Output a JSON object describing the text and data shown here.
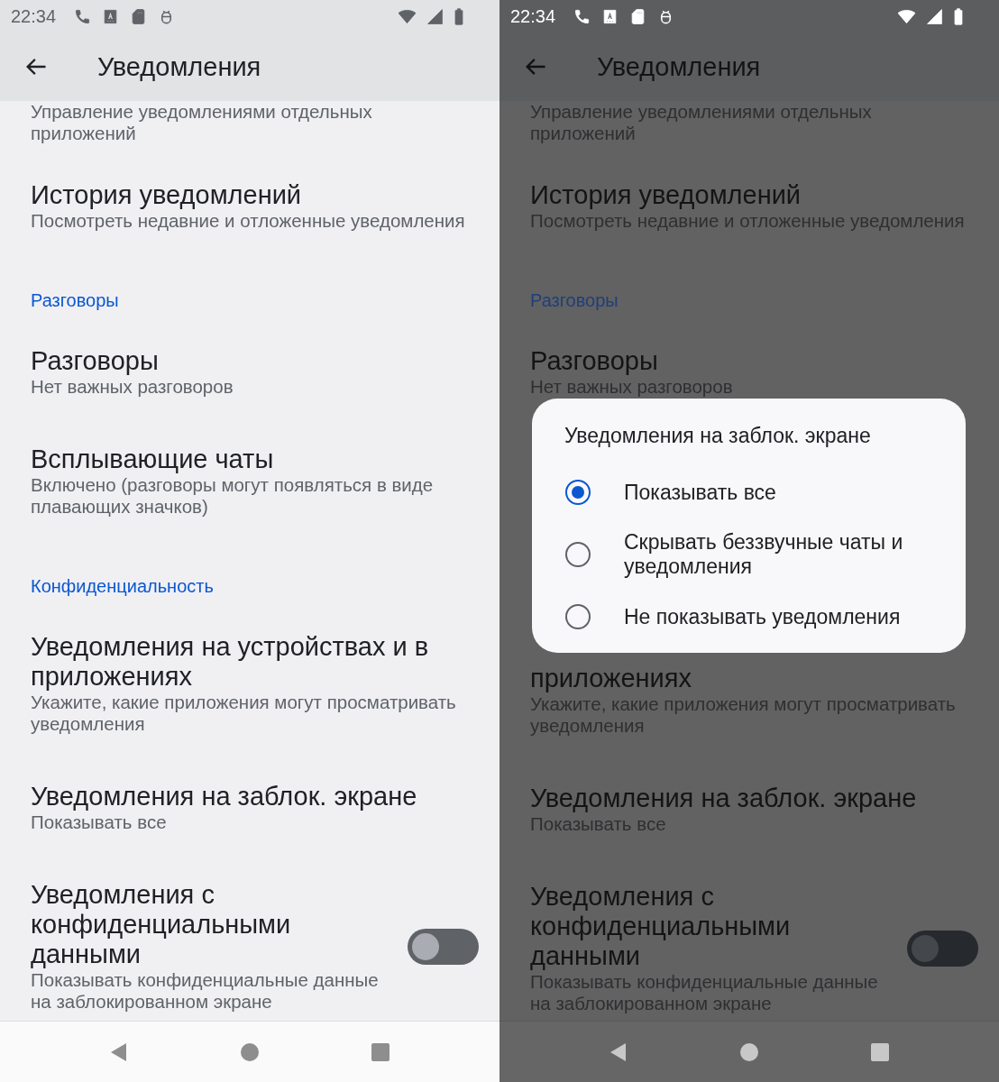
{
  "screens": [
    {
      "dimmed": false,
      "status_bar": {
        "time": "22:34"
      },
      "app_bar": {
        "title": "Уведомления"
      },
      "list": [
        {
          "kind": "item",
          "subtitle": "Управление уведомлениями отдельных приложений"
        },
        {
          "kind": "item",
          "title": "История уведомлений",
          "subtitle": "Посмотреть недавние и отложенные уведомления"
        },
        {
          "kind": "header",
          "title": "Разговоры"
        },
        {
          "kind": "item",
          "title": "Разговоры",
          "subtitle": "Нет важных разговоров"
        },
        {
          "kind": "item",
          "title": "Всплывающие чаты",
          "subtitle": "Включено (разговоры могут появляться в виде плавающих значков)"
        },
        {
          "kind": "header",
          "title": "Конфиденциальность"
        },
        {
          "kind": "item",
          "title": "Уведомления на устройствах и в приложениях",
          "subtitle": "Укажите, какие приложения могут просматривать уведомления"
        },
        {
          "kind": "item",
          "title": "Уведомления на заблок. экране",
          "subtitle": "Показывать все"
        },
        {
          "kind": "toggle",
          "title": "Уведомления с конфиденциальными данными",
          "subtitle": "Показывать конфиденциальные данные на заблокированном экране",
          "on": false
        }
      ]
    },
    {
      "dimmed": true,
      "status_bar": {
        "time": "22:34"
      },
      "app_bar": {
        "title": "Уведомления"
      },
      "list": [
        {
          "kind": "item",
          "subtitle": "Управление уведомлениями отдельных приложений"
        },
        {
          "kind": "item",
          "title": "История уведомлений",
          "subtitle": "Посмотреть недавние и отложенные уведомления"
        },
        {
          "kind": "header",
          "title": "Разговоры"
        },
        {
          "kind": "item",
          "title": "Разговоры",
          "subtitle": "Нет важных разговоров"
        },
        {
          "kind": "dialog",
          "title": "Уведомления на заблок. экране",
          "options": [
            {
              "label": "Показывать все",
              "selected": true
            },
            {
              "label": "Скрывать беззвучные чаты и уведомления",
              "selected": false
            },
            {
              "label": "Не показывать уведомления",
              "selected": false
            }
          ]
        },
        {
          "kind": "item",
          "title": "приложениях",
          "subtitle": "Укажите, какие приложения могут просматривать уведомления"
        },
        {
          "kind": "item",
          "title": "Уведомления на заблок. экране",
          "subtitle": "Показывать все"
        },
        {
          "kind": "toggle",
          "title": "Уведомления с конфиденциальными данными",
          "subtitle": "Показывать конфиденциальные данные на заблокированном экране",
          "on": false
        }
      ]
    }
  ]
}
